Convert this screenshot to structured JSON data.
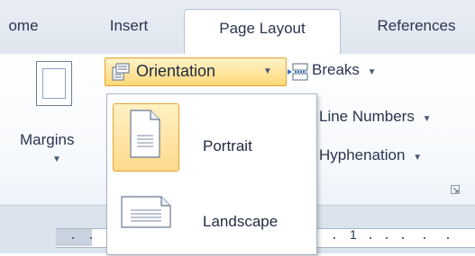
{
  "tabs": [
    {
      "label": "ome",
      "active": false
    },
    {
      "label": "Insert",
      "active": false
    },
    {
      "label": "Page Layout",
      "active": true
    },
    {
      "label": "References",
      "active": false
    }
  ],
  "ribbon": {
    "margins_label": "Margins",
    "orientation_label": "Orientation",
    "breaks_label": "Breaks",
    "line_numbers_label": "Line Numbers",
    "hyphenation_label": "Hyphenation"
  },
  "orientation_menu": {
    "options": [
      {
        "label": "Portrait",
        "selected": true
      },
      {
        "label": "Landscape",
        "selected": false
      }
    ]
  },
  "ruler": {
    "marker": "1"
  },
  "colors": {
    "accent_border": "#e2a32a",
    "accent_fill": "#ffd879",
    "tab_bg": "#dfe6ef"
  },
  "icons": [
    "margins-icon",
    "orientation-icon",
    "breaks-icon",
    "portrait-page-icon",
    "landscape-page-icon",
    "dialog-launcher-icon",
    "chevron-down-icon"
  ]
}
